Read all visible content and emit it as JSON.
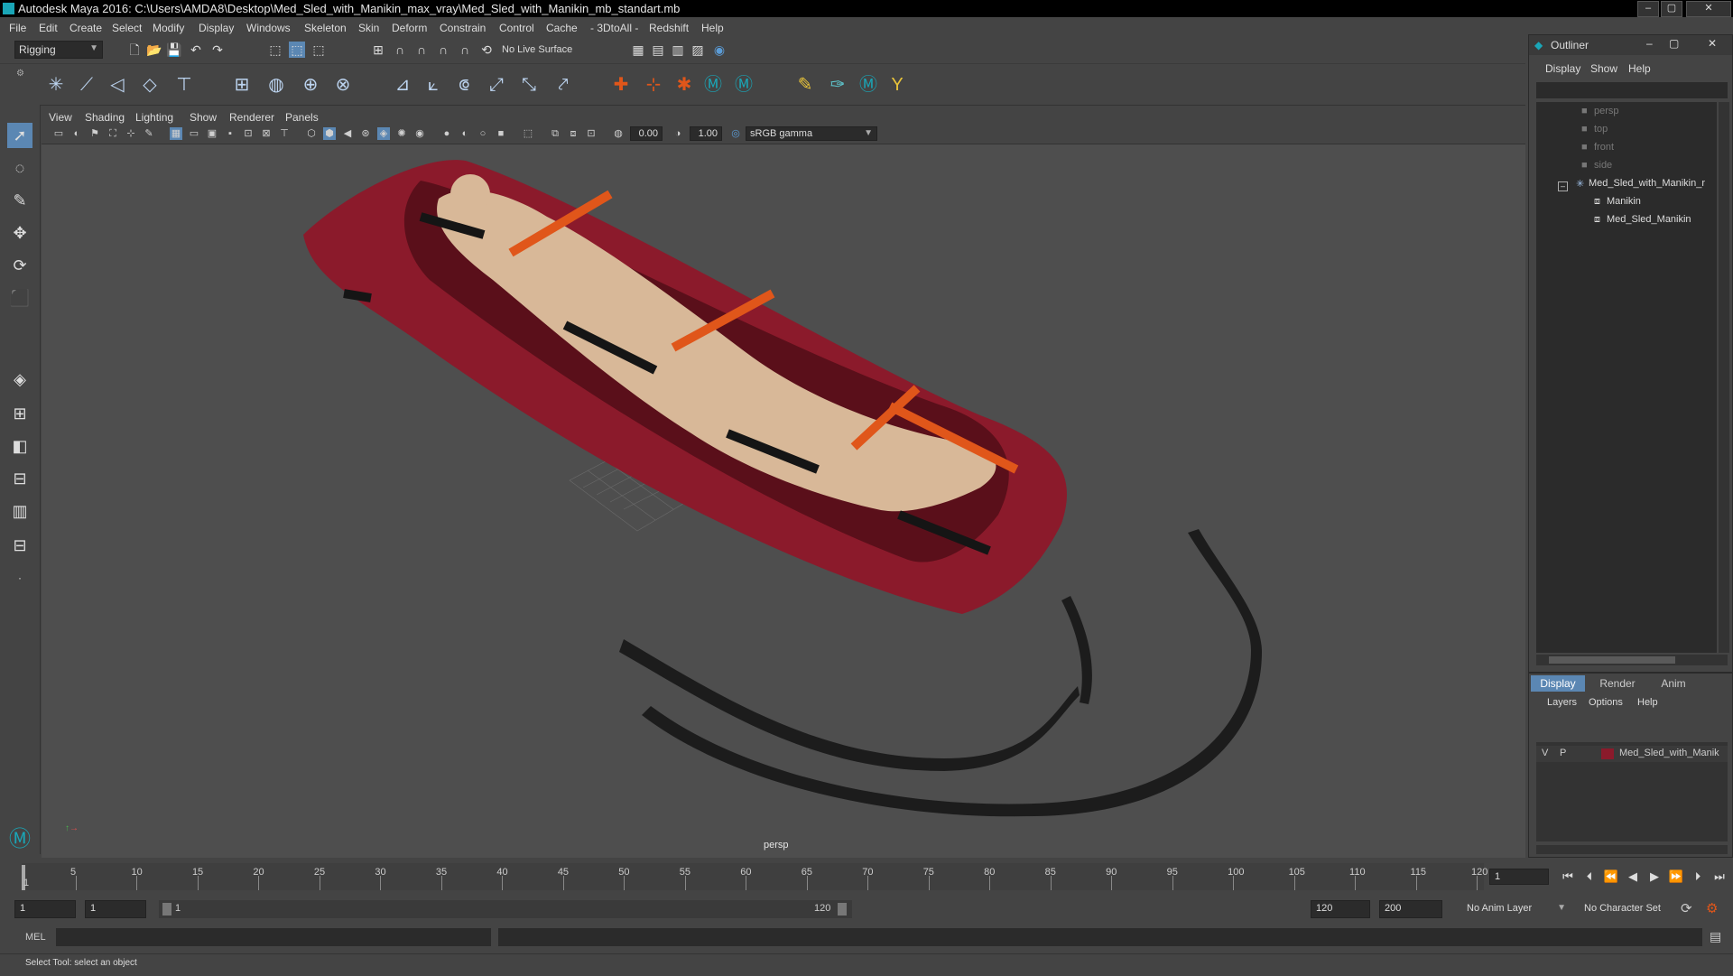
{
  "title_bar": {
    "title": "Autodesk Maya 2016: C:\\Users\\AMDA8\\Desktop\\Med_Sled_with_Manikin_max_vray\\Med_Sled_with_Manikin_mb_standart.mb",
    "minimize": "–",
    "maximize": "▢",
    "close": "✕"
  },
  "menu": [
    "File",
    "Edit",
    "Create",
    "Select",
    "Modify",
    "Display",
    "Windows",
    "Skeleton",
    "Skin",
    "Deform",
    "Constrain",
    "Control",
    "Cache",
    "- 3DtoAll -",
    "Redshift",
    "Help"
  ],
  "status_line": {
    "menuset": "Rigging",
    "live_surface": "No Live Surface"
  },
  "panel_menu": [
    "View",
    "Shading",
    "Lighting",
    "Show",
    "Renderer",
    "Panels"
  ],
  "panel_toolbar": {
    "exposure": "0.00",
    "gamma": "1.00",
    "color_space": "sRGB gamma"
  },
  "viewport": {
    "camera_label": "persp"
  },
  "outliner": {
    "title": "Outliner",
    "menu": [
      "Display",
      "Show",
      "Help"
    ],
    "items": [
      {
        "label": "persp",
        "dim": true
      },
      {
        "label": "top",
        "dim": true
      },
      {
        "label": "front",
        "dim": true
      },
      {
        "label": "side",
        "dim": true
      },
      {
        "label": "Med_Sled_with_Manikin_r",
        "dim": false
      },
      {
        "label": "Manikin",
        "dim": false
      },
      {
        "label": "Med_Sled_Manikin",
        "dim": false
      }
    ]
  },
  "layer_editor": {
    "tabs": [
      "Display",
      "Render",
      "Anim"
    ],
    "menu": [
      "Layers",
      "Options",
      "Help"
    ],
    "layer": {
      "v": "V",
      "p": "P",
      "name": "Med_Sled_with_Manik",
      "color": "#8b1a2b"
    }
  },
  "time_slider": {
    "ticks": [
      "5",
      "10",
      "15",
      "20",
      "25",
      "30",
      "35",
      "40",
      "45",
      "50",
      "55",
      "60",
      "65",
      "70",
      "75",
      "80",
      "85",
      "90",
      "95",
      "100",
      "105",
      "110",
      "115",
      "120"
    ],
    "current_frame_marker": "1",
    "current_frame": "1"
  },
  "range_slider": {
    "start": "1",
    "range_start": "1",
    "range_handle_start": "1",
    "range_handle_end": "120",
    "range_end": "120",
    "end": "200",
    "anim_layer": "No Anim Layer",
    "character_set": "No Character Set"
  },
  "command_line": {
    "label": "MEL"
  },
  "help_line": {
    "text": "Select Tool: select an object"
  },
  "colors": {
    "sled": "#8b1a2b",
    "strap": "#e0561a",
    "skin": "#d8b898",
    "accent": "#5b9bd5"
  }
}
